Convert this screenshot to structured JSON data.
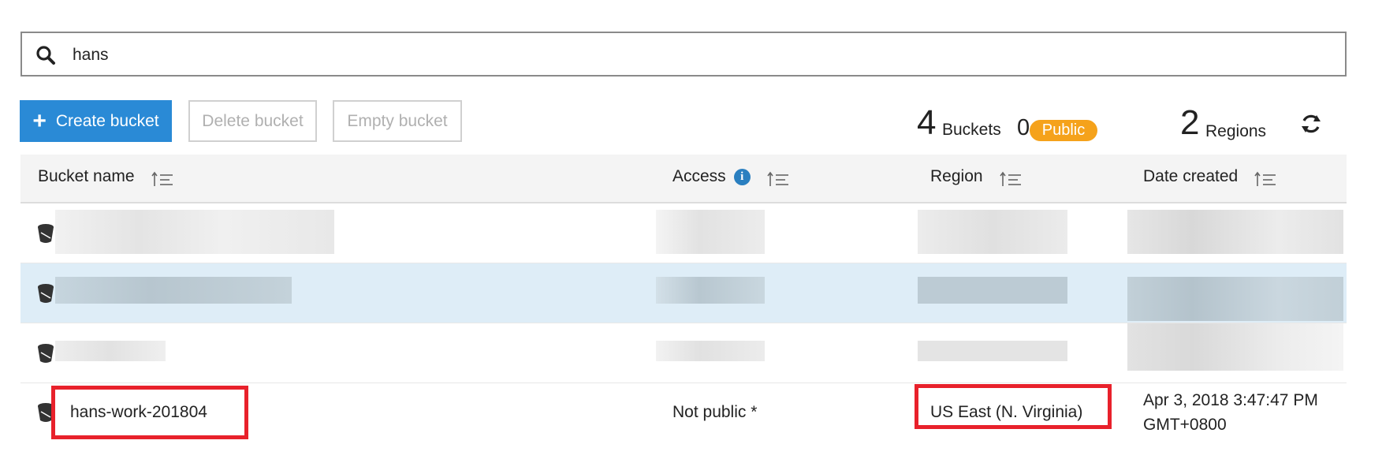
{
  "search": {
    "value": "hans",
    "icon": "search-icon"
  },
  "toolbar": {
    "create_label": "Create bucket",
    "delete_label": "Delete bucket",
    "empty_label": "Empty bucket"
  },
  "stats": {
    "buckets_count": "4",
    "buckets_label": "Buckets",
    "public_count": "0",
    "public_label": "Public",
    "regions_count": "2",
    "regions_label": "Regions"
  },
  "table": {
    "columns": [
      "Bucket name",
      "Access",
      "Region",
      "Date created"
    ],
    "visible_row": {
      "name": "hans-work-201804",
      "access": "Not public *",
      "region": "US East (N. Virginia)",
      "date_line1": "Apr 3, 2018 3:47:47 PM",
      "date_line2": "GMT+0800"
    }
  },
  "colors": {
    "primary": "#2a8ad6",
    "public_badge": "#f5a21b",
    "highlight": "#e8212b",
    "selected_row": "#deedf7"
  }
}
